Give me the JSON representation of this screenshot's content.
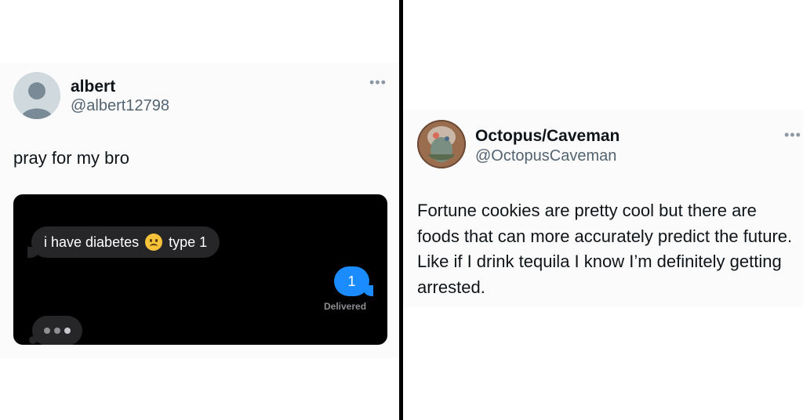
{
  "tweet_left": {
    "display_name": "albert",
    "handle": "@albert12798",
    "more_icon": "more-horizontal-icon",
    "text": "pray for my bro",
    "embedded_screenshot": {
      "incoming_message_part1": "i have diabetes",
      "incoming_emoji": "slightly-frowning-face-emoji",
      "incoming_message_part2": "type 1",
      "outgoing_message": "1",
      "delivered_label": "Delivered",
      "typing_indicator": "typing-dots-icon",
      "colors": {
        "outgoing_bubble": "#1a8cff",
        "incoming_bubble": "#262628",
        "background": "#000000"
      }
    }
  },
  "tweet_right": {
    "display_name": "Octopus/Caveman",
    "handle": "@OctopusCaveman",
    "more_icon": "more-horizontal-icon",
    "text": "Fortune cookies are pretty cool but there are foods that can more accurately predict the future. Like if I drink tequila I know I’m definitely getting arrested."
  },
  "colors": {
    "name": "#0f1419",
    "handle": "#536471",
    "divider": "#000000"
  }
}
